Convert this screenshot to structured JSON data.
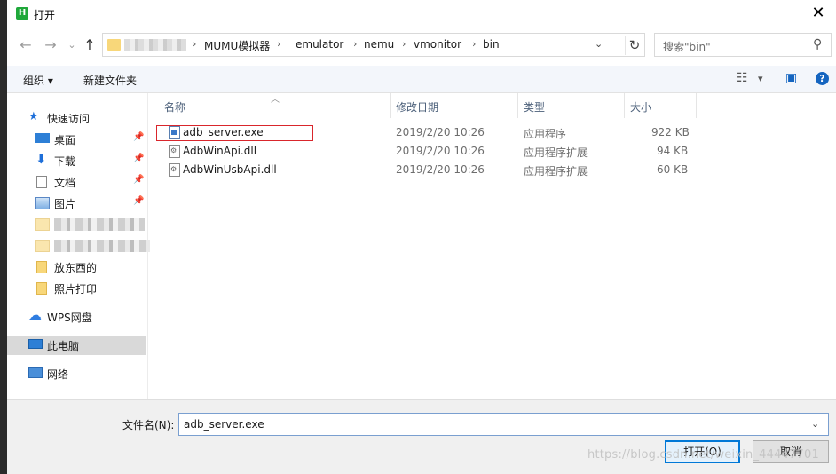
{
  "window": {
    "title": "打开",
    "app_icon_letter": "H"
  },
  "nav": {
    "back": "←",
    "forward": "→",
    "recent": "⌄",
    "up": "↑"
  },
  "address": {
    "crumbs": [
      "MUMU模拟器",
      "emulator",
      "nemu",
      "vmonitor",
      "bin"
    ],
    "separator": "›",
    "dropdown": "⌄",
    "refresh": "↻"
  },
  "search": {
    "placeholder": "搜索\"bin\""
  },
  "toolbar": {
    "organize": "组织 ▾",
    "new_folder": "新建文件夹",
    "view_icon": "☷",
    "view_dd": "▾",
    "pane_icon": "▣",
    "help": "?"
  },
  "sidebar": {
    "quick_access": "快速访问",
    "items": [
      {
        "label": "桌面"
      },
      {
        "label": "下载"
      },
      {
        "label": "文档"
      },
      {
        "label": "图片"
      },
      {
        "label": "放东西的"
      },
      {
        "label": "照片打印"
      }
    ],
    "wps": "WPS网盘",
    "this_pc": "此电脑",
    "network": "网络"
  },
  "columns": {
    "name": "名称",
    "date": "修改日期",
    "type": "类型",
    "size": "大小"
  },
  "files": [
    {
      "name": "adb_server.exe",
      "date": "2019/2/20 10:26",
      "type": "应用程序",
      "size": "922 KB",
      "icon": "exe-icon"
    },
    {
      "name": "AdbWinApi.dll",
      "date": "2019/2/20 10:26",
      "type": "应用程序扩展",
      "size": "94 KB",
      "icon": "dll-icon"
    },
    {
      "name": "AdbWinUsbApi.dll",
      "date": "2019/2/20 10:26",
      "type": "应用程序扩展",
      "size": "60 KB",
      "icon": "dll-icon"
    }
  ],
  "filename": {
    "label": "文件名(N):",
    "value": "adb_server.exe"
  },
  "buttons": {
    "open": "打开(O)",
    "cancel": "取消"
  },
  "watermark": "https://blog.csdn.net/weixin_44447701",
  "colors": {
    "accent": "#0078d7",
    "highlight": "#d9262c",
    "selected_nav": "#d9d9d9"
  }
}
